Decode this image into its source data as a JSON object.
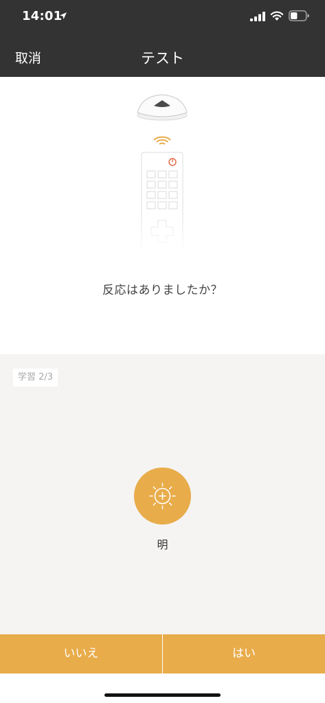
{
  "status_bar": {
    "time": "14:01",
    "icons": [
      "location-arrow-icon",
      "cellular-signal-icon",
      "wifi-icon",
      "battery-icon"
    ]
  },
  "nav": {
    "cancel_label": "取消",
    "title": "テスト"
  },
  "illustration": {
    "icon": "hub-and-remote-illustration",
    "question": "反応はありましたか？"
  },
  "learning": {
    "badge": "学習  2/3",
    "button_icon": "sun-brightness-plus-icon",
    "button_label": "明"
  },
  "actions": {
    "no_label": "いいえ",
    "yes_label": "はい"
  },
  "colors": {
    "header_bg": "#333333",
    "accent": "#e8ac4a",
    "learn_bg": "#f5f4f2",
    "power_red": "#e0633e"
  }
}
